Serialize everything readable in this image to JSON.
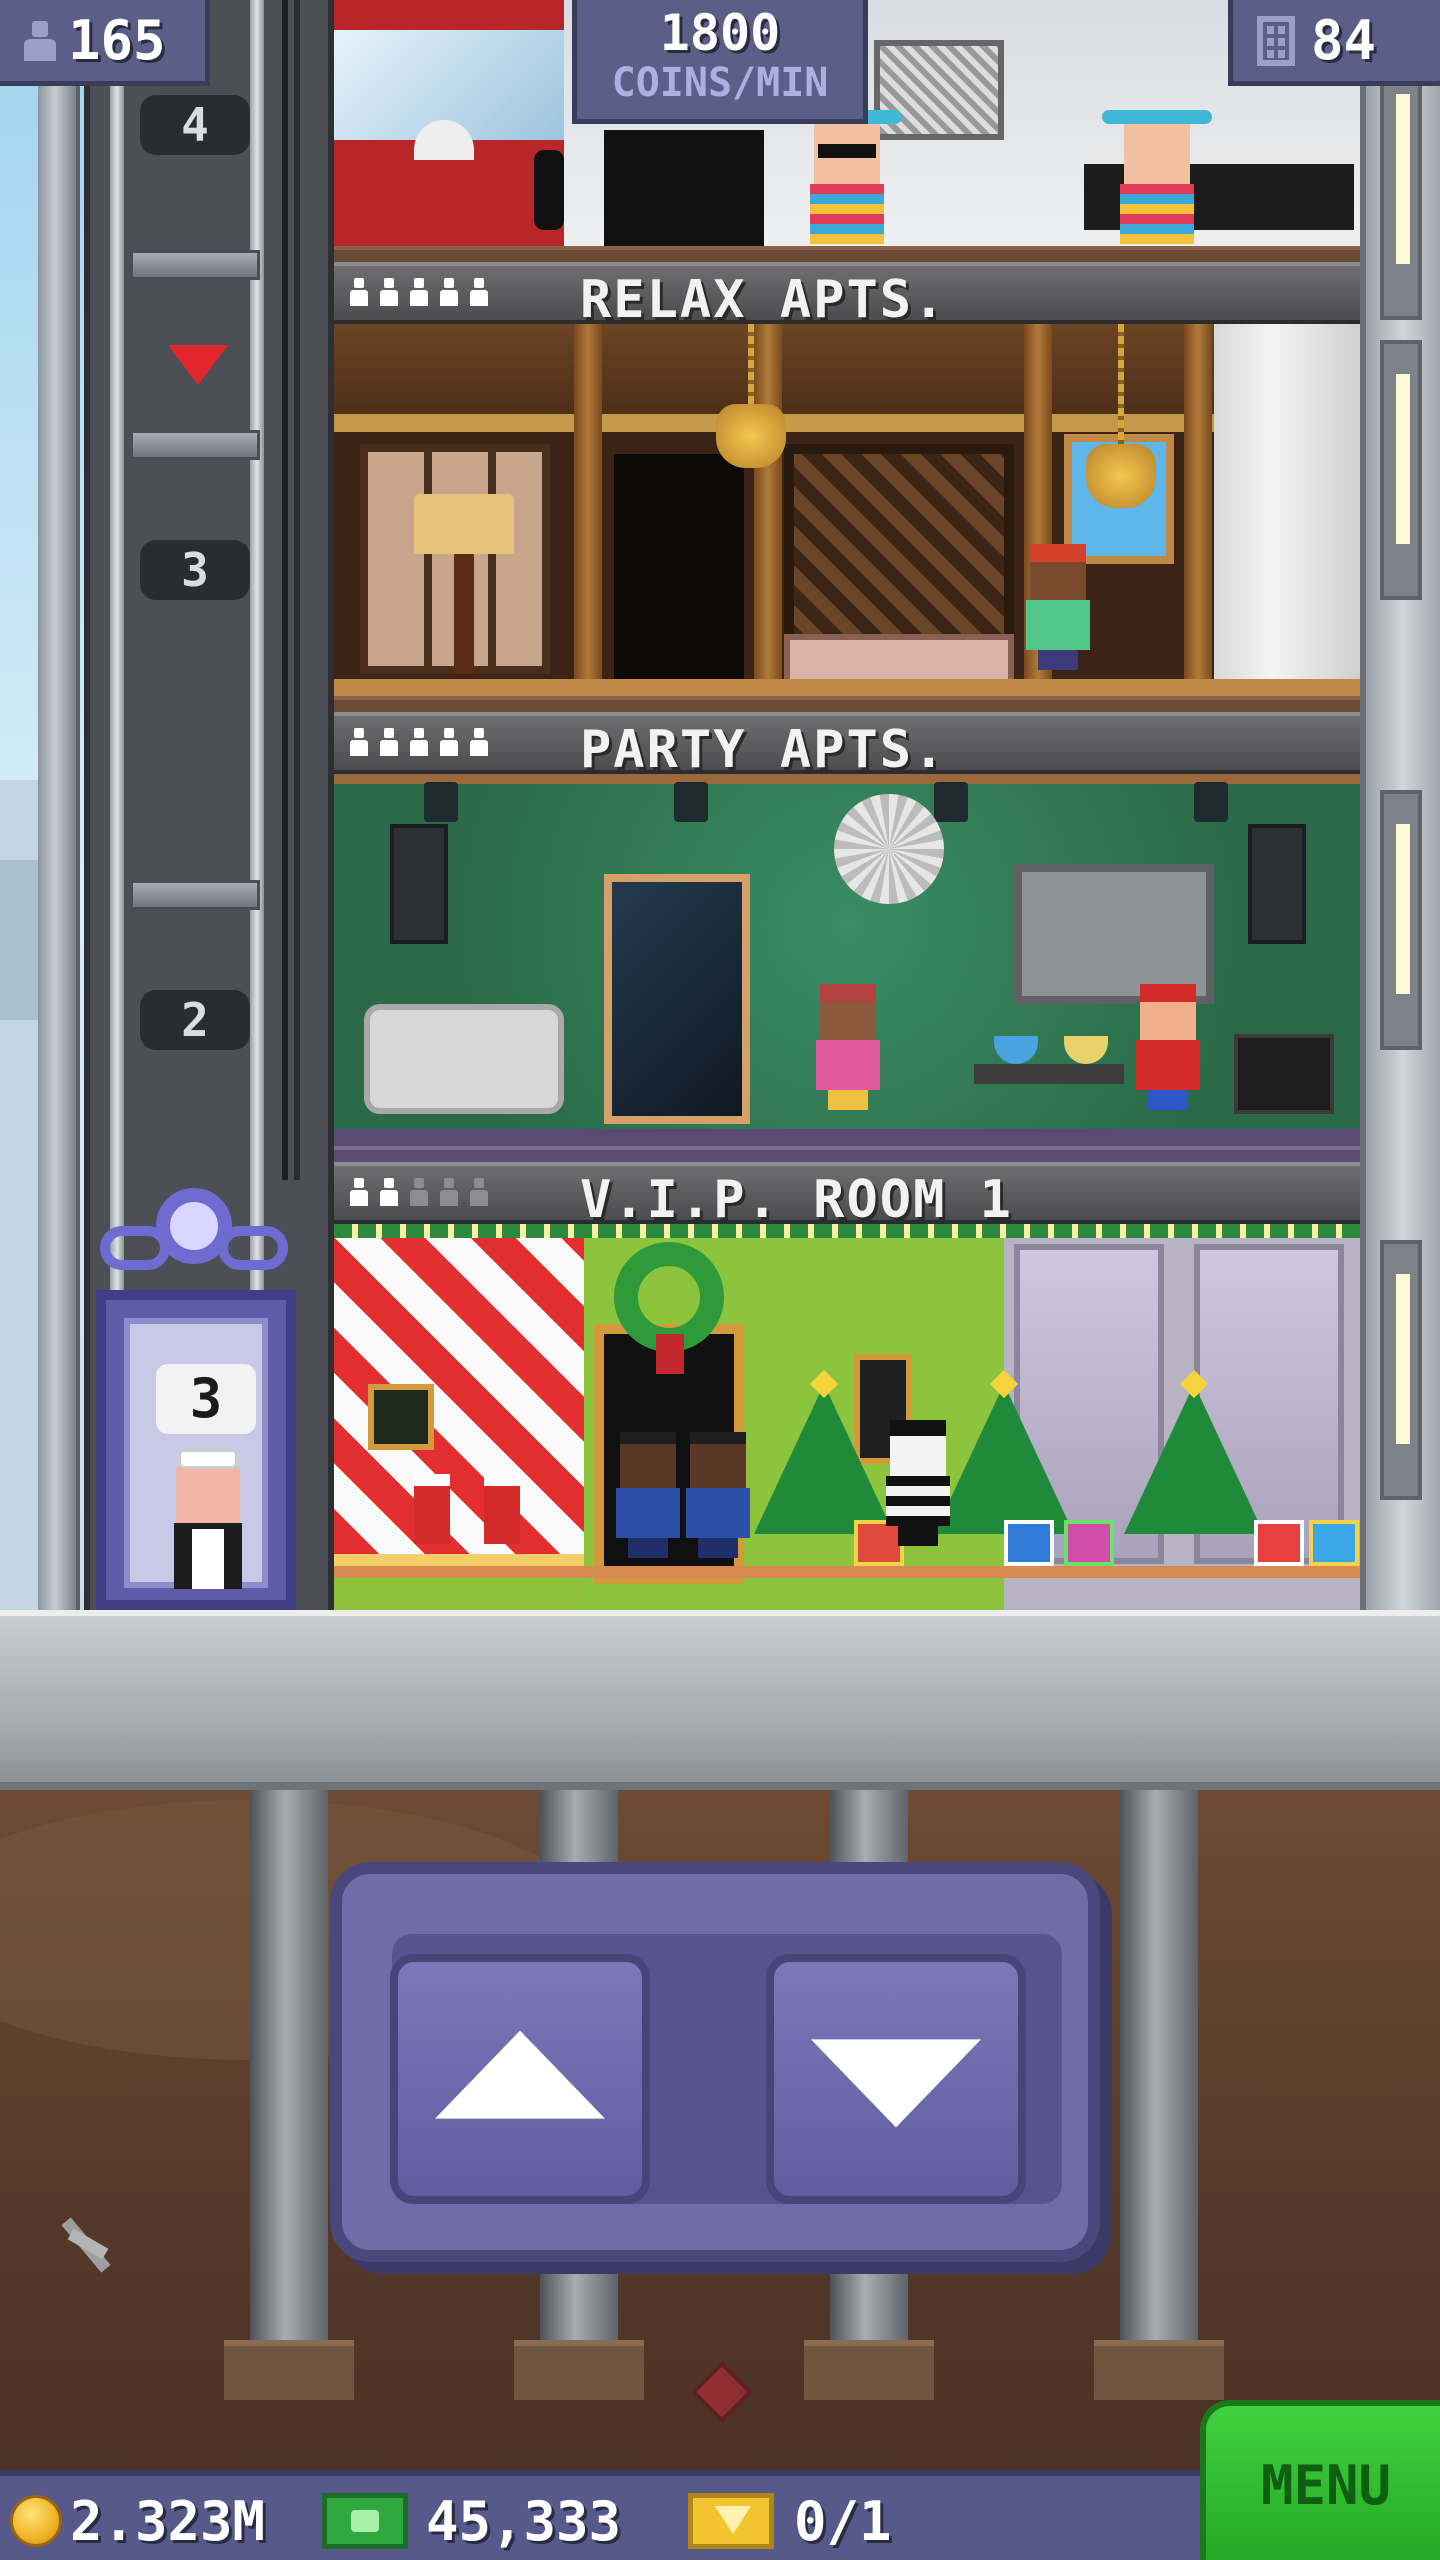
{
  "hud": {
    "population": "165",
    "rate_value": "1800",
    "rate_unit": "COINS/MIN",
    "floor_count": "84"
  },
  "floors": [
    {
      "name": "RELAX APTS.",
      "residents_filled": 5,
      "residents_max": 5
    },
    {
      "name": "PARTY APTS.",
      "residents_filled": 5,
      "residents_max": 5
    },
    {
      "name": "V.I.P. ROOM 1",
      "residents_filled": 2,
      "residents_max": 5
    }
  ],
  "elevator": {
    "shaft_markers": [
      "4",
      "3",
      "2"
    ],
    "current_floor": "3"
  },
  "controls": {
    "up_icon": "arrow-up-icon",
    "down_icon": "arrow-down-icon"
  },
  "footer": {
    "coins": "2.323M",
    "tower_bux": "45,333",
    "vip_tickets": "0/1",
    "menu_label": "MENU"
  },
  "colors": {
    "hud_panel": "#5b5e86",
    "menu_green": "#2fc22f",
    "elevator_purple": "#6e6bd1",
    "coin_gold": "#f0b323"
  }
}
